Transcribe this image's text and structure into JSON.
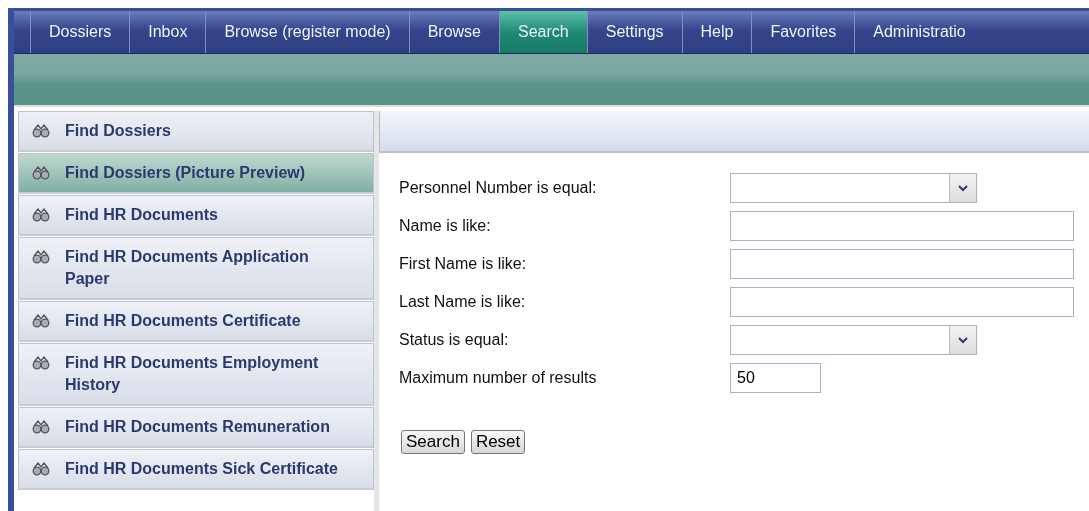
{
  "tabs": [
    {
      "label": "Dossiers",
      "selected": false
    },
    {
      "label": "Inbox",
      "selected": false
    },
    {
      "label": "Browse (register mode)",
      "selected": false
    },
    {
      "label": "Browse",
      "selected": false
    },
    {
      "label": "Search",
      "selected": true
    },
    {
      "label": "Settings",
      "selected": false
    },
    {
      "label": "Help",
      "selected": false
    },
    {
      "label": "Favorites",
      "selected": false
    },
    {
      "label": "Administratio",
      "selected": false
    }
  ],
  "sidebar": {
    "items": [
      {
        "label": "Find Dossiers",
        "selected": false
      },
      {
        "label": "Find Dossiers (Picture Preview)",
        "selected": true
      },
      {
        "label": "Find HR Documents",
        "selected": false
      },
      {
        "label": "Find HR Documents Application Paper",
        "selected": false
      },
      {
        "label": "Find HR Documents Certificate",
        "selected": false
      },
      {
        "label": "Find HR Documents Employment History",
        "selected": false
      },
      {
        "label": "Find HR Documents Remuneration",
        "selected": false
      },
      {
        "label": "Find HR Documents Sick Certificate",
        "selected": false
      }
    ]
  },
  "form": {
    "fields": [
      {
        "label": "Personnel Number is equal:",
        "kind": "select"
      },
      {
        "label": "Name is like:",
        "kind": "text"
      },
      {
        "label": "First Name is like:",
        "kind": "text"
      },
      {
        "label": "Last Name is like:",
        "kind": "text"
      },
      {
        "label": "Status is equal:",
        "kind": "select"
      },
      {
        "label": "Maximum number of results",
        "kind": "number",
        "value": "50"
      }
    ],
    "buttons": [
      "Search",
      "Reset"
    ]
  }
}
